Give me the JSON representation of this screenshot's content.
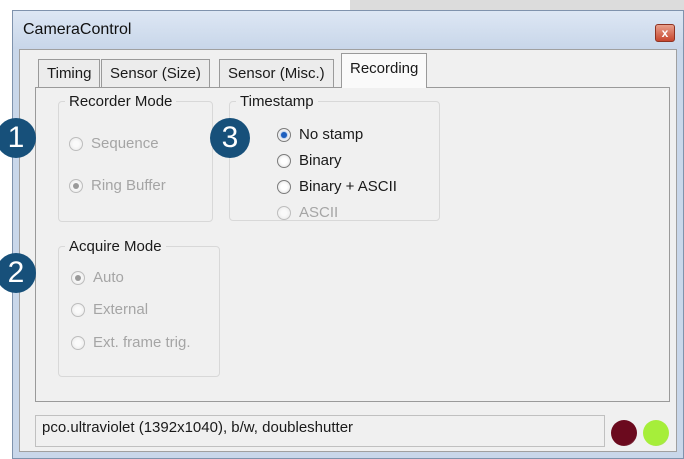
{
  "window": {
    "title": "CameraControl",
    "close_glyph": "x"
  },
  "tabs": [
    {
      "label": "Timing",
      "active": false
    },
    {
      "label": "Sensor (Size)",
      "active": false
    },
    {
      "label": "Sensor (Misc.)",
      "active": false
    },
    {
      "label": "Recording",
      "active": true
    }
  ],
  "recorder_mode": {
    "title": "Recorder Mode",
    "options": [
      {
        "label": "Sequence",
        "checked": false,
        "enabled": false
      },
      {
        "label": "Ring Buffer",
        "checked": true,
        "enabled": false
      }
    ]
  },
  "acquire_mode": {
    "title": "Acquire Mode",
    "options": [
      {
        "label": "Auto",
        "checked": true,
        "enabled": false
      },
      {
        "label": "External",
        "checked": false,
        "enabled": false
      },
      {
        "label": "Ext. frame trig.",
        "checked": false,
        "enabled": false
      }
    ]
  },
  "timestamp": {
    "title": "Timestamp",
    "options": [
      {
        "label": "No stamp",
        "checked": true,
        "enabled": true
      },
      {
        "label": "Binary",
        "checked": false,
        "enabled": true
      },
      {
        "label": "Binary + ASCII",
        "checked": false,
        "enabled": true
      },
      {
        "label": "ASCII",
        "checked": false,
        "enabled": false
      }
    ]
  },
  "status": {
    "text": "pco.ultraviolet (1392x1040), b/w, doubleshutter",
    "led_colors": [
      "#6b0a1e",
      "#a6ee3a"
    ]
  },
  "badges": [
    "1",
    "2",
    "3"
  ],
  "colors": {
    "badge": "#17507a",
    "selected_radio": "#1c5fbf"
  }
}
